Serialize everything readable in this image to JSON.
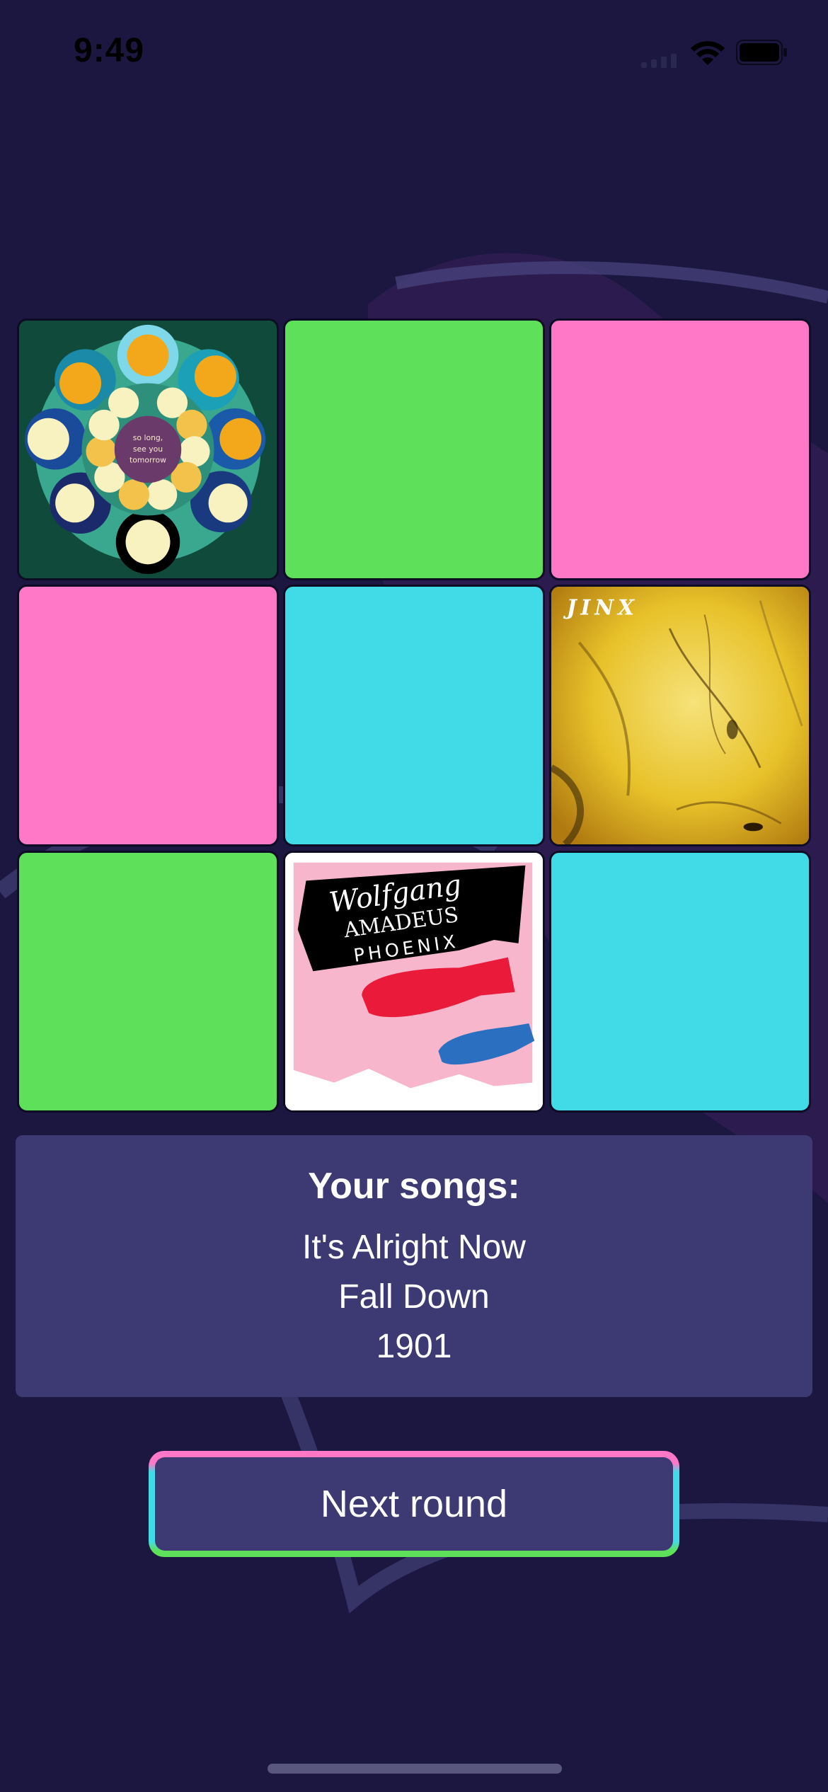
{
  "status_bar": {
    "time": "9:49"
  },
  "grid": {
    "tiles": [
      {
        "type": "album",
        "album": "so-long-see-you-tomorrow",
        "art_text": "so long,\nsee you\ntomorrow"
      },
      {
        "type": "color",
        "color": "#5ee05a"
      },
      {
        "type": "color",
        "color": "#ff78c8"
      },
      {
        "type": "color",
        "color": "#ff78c8"
      },
      {
        "type": "color",
        "color": "#41dbe8"
      },
      {
        "type": "album",
        "album": "jinx",
        "art_text": "JINX"
      },
      {
        "type": "color",
        "color": "#5ee05a"
      },
      {
        "type": "album",
        "album": "wolfgang-amadeus-phoenix",
        "art_text": "Wolfgang AMADEUS PHOENIX"
      },
      {
        "type": "color",
        "color": "#41dbe8"
      }
    ]
  },
  "songs": {
    "title": "Your songs:",
    "items": [
      "It's Alright Now",
      "Fall Down",
      "1901"
    ]
  },
  "next_button": {
    "label": "Next round"
  },
  "colors": {
    "background": "#1b1740",
    "panel": "#3d3a73",
    "green": "#5ee05a",
    "pink": "#ff78c8",
    "cyan": "#41dbe8"
  }
}
